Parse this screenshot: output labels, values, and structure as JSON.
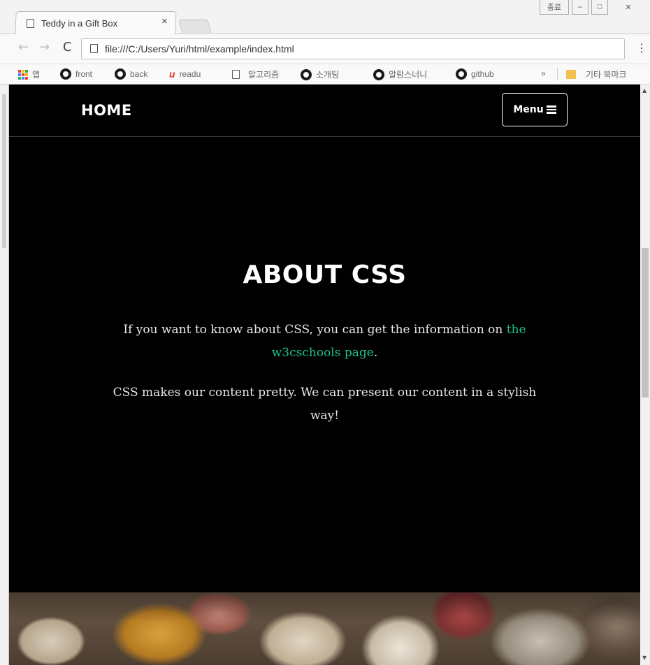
{
  "browser": {
    "tab_title": "Teddy in a Gift Box",
    "tab_close": "×",
    "url": "file:///C:/Users/Yuri/html/example/index.html",
    "window_controls": [
      "종료",
      "–",
      "□",
      "✕"
    ],
    "bookmarks": [
      {
        "label": "앱",
        "icon": "apps-grid-icon"
      },
      {
        "label": "front",
        "icon": "github-icon"
      },
      {
        "label": "back",
        "icon": "github-icon"
      },
      {
        "label": "readu",
        "icon": "udemy-icon"
      },
      {
        "label": "알고리즘",
        "icon": "page-icon"
      },
      {
        "label": "소개팅",
        "icon": "github-icon"
      },
      {
        "label": "알람스너니",
        "icon": "github-icon"
      },
      {
        "label": "github",
        "icon": "github-icon"
      }
    ],
    "more_bookmarks": "»",
    "other_bookmarks": "기타 북마크"
  },
  "site": {
    "brand": "HOME",
    "menu_label": "Menu"
  },
  "about": {
    "heading": "ABOUT CSS",
    "para1_before": "If you want to know about CSS, you can get the information on ",
    "para1_link": "the w3cschools page",
    "para1_after": ".",
    "para2": "CSS makes our content pretty. We can present our content in a stylish way!"
  },
  "colors": {
    "page_bg": "#000000",
    "link": "#1fbf8f",
    "text": "#ffffff"
  }
}
